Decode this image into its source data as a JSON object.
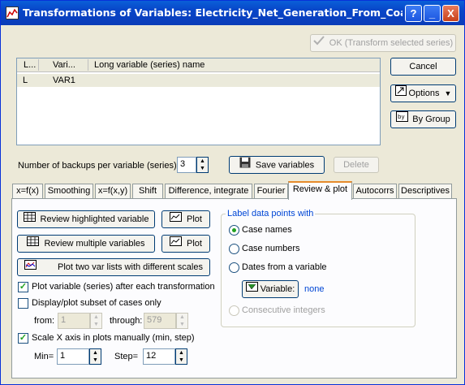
{
  "window": {
    "title": "Transformations of Variables: Electricity_Net_Generation_From_Coal_Electri",
    "help": "?",
    "minimize": "_",
    "close": "X"
  },
  "list": {
    "headers": [
      "L...",
      "Vari...",
      "Long variable (series) name"
    ],
    "rows": [
      {
        "l": "L",
        "var": "VAR1",
        "long": ""
      }
    ]
  },
  "buttons": {
    "ok": "OK (Transform selected series)",
    "cancel": "Cancel",
    "options": "Options",
    "by_group": "By Group",
    "save_variables": "Save variables",
    "delete": "Delete"
  },
  "backups": {
    "label": "Number of backups per variable (series):",
    "value": "3"
  },
  "tabs": [
    {
      "label": "x=f(x)",
      "active": false
    },
    {
      "label": "Smoothing",
      "active": false
    },
    {
      "label": "x=f(x,y)",
      "active": false
    },
    {
      "label": "Shift",
      "active": false
    },
    {
      "label": "Difference, integrate",
      "active": false
    },
    {
      "label": "Fourier",
      "active": false
    },
    {
      "label": "Review & plot",
      "active": true
    },
    {
      "label": "Autocorrs",
      "active": false
    },
    {
      "label": "Descriptives",
      "active": false
    }
  ],
  "review": {
    "highlighted": "Review highlighted variable",
    "multiple": "Review multiple variables",
    "plot": "Plot",
    "two_lists": "Plot two var lists with different scales",
    "plot_after": "Plot variable (series) after each transformation",
    "subset": "Display/plot subset of cases only",
    "from_label": "from:",
    "from_value": "1",
    "through_label": "through:",
    "through_value": "579",
    "scale_x": "Scale X axis in plots manually (min, step)",
    "min_label": "Min=",
    "min_value": "1",
    "step_label": "Step=",
    "step_value": "12"
  },
  "checks": {
    "plot_after": true,
    "subset": false,
    "scale_x": true
  },
  "label_group": {
    "title": "Label data points with",
    "options": [
      "Case names",
      "Case numbers",
      "Dates from a variable",
      "Consecutive integers"
    ],
    "selected": 0,
    "variable_button": "Variable:",
    "variable_value": "none"
  },
  "colors": {
    "accent": "#0046d5",
    "title_bar": "#0a5fd8",
    "tab_highlight": "#e68b2c",
    "check": "#21a121"
  }
}
